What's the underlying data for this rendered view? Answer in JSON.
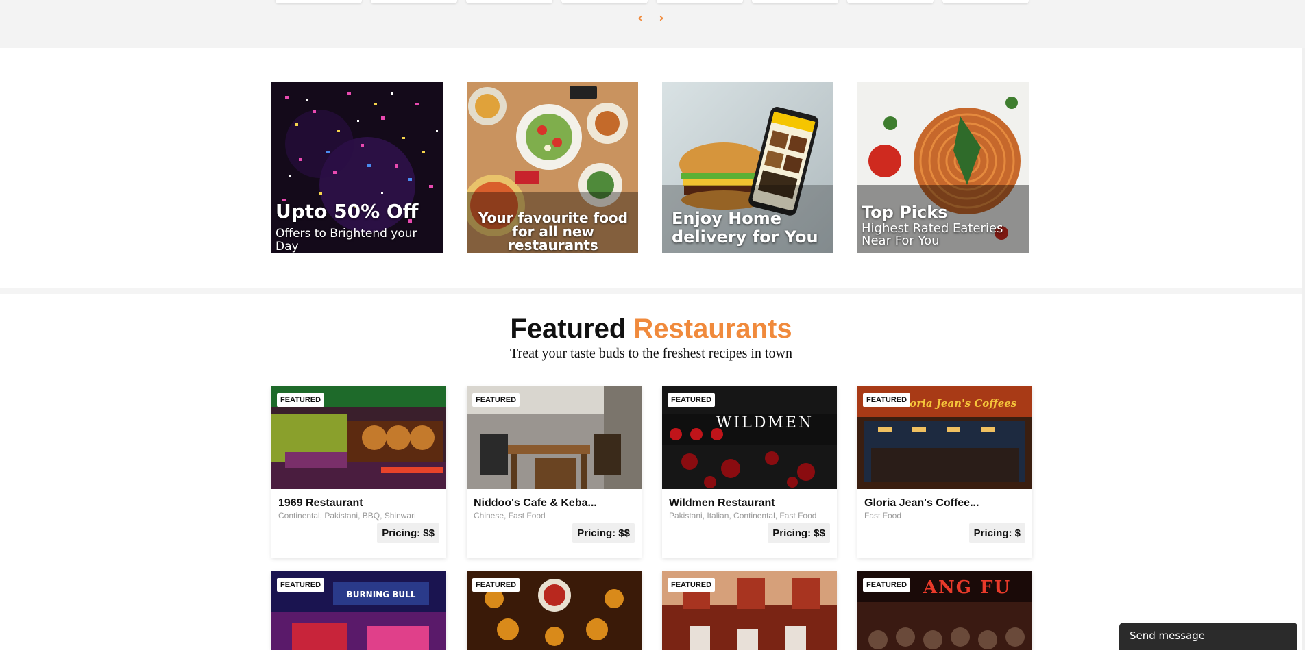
{
  "carousel": {
    "prev_icon": "‹",
    "next_icon": "›",
    "category_cards": 8
  },
  "promos": [
    {
      "title": "Upto 50% Off",
      "subtitle": "Offers to Brightend your Day"
    },
    {
      "title": "",
      "subtitle": "Your favourite food for all new restaurants"
    },
    {
      "title": "",
      "subtitle": "Enjoy Home delivery for You"
    },
    {
      "title": "Top Picks",
      "subtitle": "Highest Rated Eateries Near For You"
    }
  ],
  "featured": {
    "title_plain": "Featured",
    "title_accent": "Restaurants",
    "subtitle": "Treat your taste buds to the freshest recipes in town",
    "badge": "FEATURED",
    "restaurants": [
      {
        "name": "1969 Restaurant",
        "cuisine": "Continental, Pakistani, BBQ, Shinwari",
        "pricing": "Pricing: $$"
      },
      {
        "name": "Niddoo's Cafe & Keba...",
        "cuisine": "Chinese, Fast Food",
        "pricing": "Pricing: $$"
      },
      {
        "name": "Wildmen Restaurant",
        "cuisine": "Pakistani, Italian, Continental, Fast Food",
        "pricing": "Pricing: $$"
      },
      {
        "name": "Gloria Jean's Coffee...",
        "cuisine": "Fast Food",
        "pricing": "Pricing: $"
      }
    ],
    "photo_signs": [
      "WILDMEN",
      "Gloria Jean's Coffees",
      "BURNING BULL",
      "ANG FU"
    ]
  },
  "chat": {
    "label": "Send message"
  },
  "colors": {
    "accent": "#f08a3c",
    "strip": "#f3f3f3",
    "chat": "#2b2b2b"
  }
}
